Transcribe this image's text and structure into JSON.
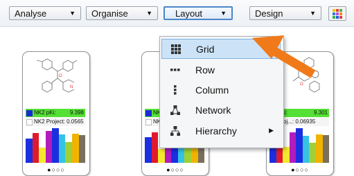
{
  "toolbar": {
    "buttons": [
      {
        "label": "Analyse"
      },
      {
        "label": "Organise"
      },
      {
        "label": "Layout"
      },
      {
        "label": "Design"
      }
    ],
    "palette_colors": [
      "#e8c520",
      "#d94b2b",
      "#4caf50",
      "#2e7bd6",
      "#b84fd1",
      "#f08a1d",
      "#37b24d",
      "#1e5bd8",
      "#e03b3b"
    ]
  },
  "cards": [
    {
      "row1_label": "NK2 pKi:",
      "row1_value": "9.398",
      "row2_label": "NK2 Project: 0.0565",
      "row2_value": "",
      "dots": "●○○○"
    },
    {
      "row1_label": "NK",
      "row1_value": "",
      "row2_label": "NK",
      "row2_value": "",
      "dots": "●○○○"
    },
    {
      "row1_label": "pKi:",
      "row1_value": "9.301",
      "row2_label": "Proj...: 0.06935",
      "row2_value": "",
      "dots": "●○○○"
    }
  ],
  "layout_menu": {
    "items": [
      {
        "label": "Grid",
        "icon": "grid-icon",
        "highlighted": true
      },
      {
        "label": "Row",
        "icon": "row-icon"
      },
      {
        "label": "Column",
        "icon": "column-icon"
      },
      {
        "label": "Network",
        "icon": "network-icon"
      },
      {
        "label": "Hierarchy",
        "icon": "hierarchy-icon",
        "submenu": true
      }
    ]
  },
  "colors": {
    "accent": "#4a86c8",
    "highlight": "#cce3f7",
    "arrow": "#f07a1a",
    "pki_row": "#55e035"
  }
}
